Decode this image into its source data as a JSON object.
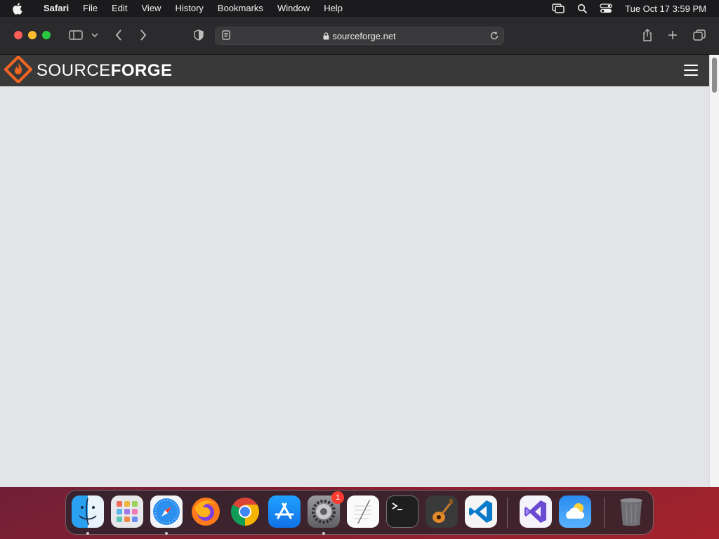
{
  "menubar": {
    "apple_icon": "apple-logo-icon",
    "app_name": "Safari",
    "items": [
      "File",
      "Edit",
      "View",
      "History",
      "Bookmarks",
      "Window",
      "Help"
    ],
    "status_icons": [
      "screen-mirroring-icon",
      "spotlight-search-icon",
      "control-center-icon"
    ],
    "clock": "Tue Oct 17  3:59 PM"
  },
  "browser": {
    "url": "sourceforge.net",
    "toolbar_icons": [
      "sidebar-toggle-icon",
      "chevron-down-icon",
      "back-arrow-icon",
      "forward-arrow-icon",
      "privacy-shield-icon",
      "reader-view-icon",
      "lock-icon",
      "reload-icon",
      "share-icon",
      "new-tab-plus-icon",
      "tab-overview-icon"
    ]
  },
  "site": {
    "logo_light": "SOURCE",
    "logo_bold": "FORGE",
    "logo_icon": "sourceforge-logo-icon",
    "menu_icon": "hamburger-menu-icon",
    "brand_color": "#f26522",
    "header_color": "#393939",
    "body_color": "#e3e4e8"
  },
  "dock": {
    "apps": [
      {
        "name": "Finder",
        "icon": "finder-icon",
        "running": true
      },
      {
        "name": "Launchpad",
        "icon": "launchpad-icon",
        "running": false
      },
      {
        "name": "Safari",
        "icon": "safari-icon",
        "running": true
      },
      {
        "name": "Firefox",
        "icon": "firefox-icon",
        "running": false
      },
      {
        "name": "Chrome",
        "icon": "chrome-icon",
        "running": false
      },
      {
        "name": "App Store",
        "icon": "app-store-icon",
        "running": false
      },
      {
        "name": "System Settings",
        "icon": "system-settings-icon",
        "running": true,
        "badge": "1"
      },
      {
        "name": "TextEdit",
        "icon": "textedit-icon",
        "running": false
      },
      {
        "name": "Terminal",
        "icon": "terminal-icon",
        "running": false
      },
      {
        "name": "GarageBand",
        "icon": "garageband-icon",
        "running": false
      },
      {
        "name": "Visual Studio Code",
        "icon": "vscode-icon",
        "running": false
      },
      {
        "name": "Visual Studio",
        "icon": "visual-studio-icon",
        "running": false
      },
      {
        "name": "Weather",
        "icon": "weather-icon",
        "running": false
      },
      {
        "name": "Trash",
        "icon": "trash-icon",
        "running": false
      }
    ]
  }
}
